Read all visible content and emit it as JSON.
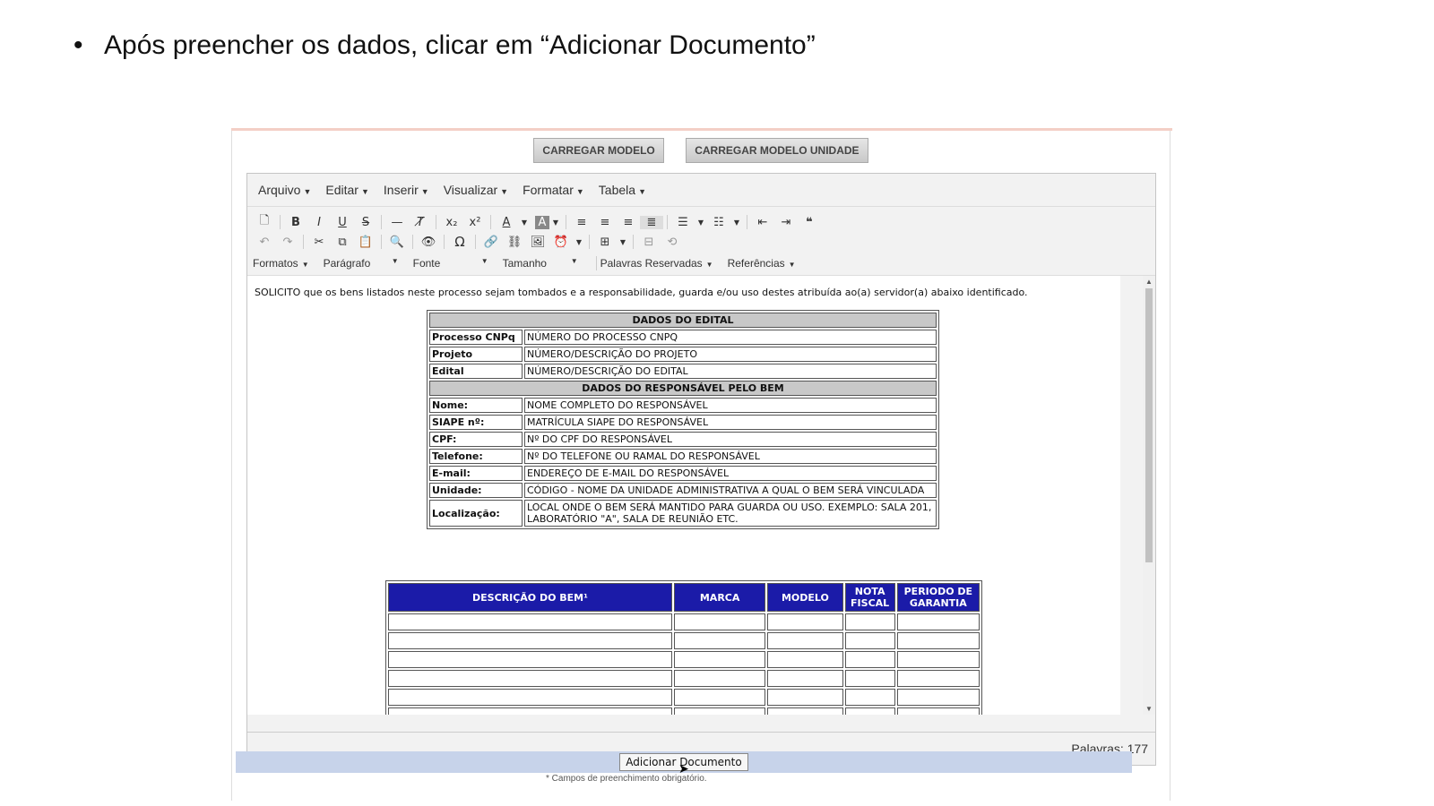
{
  "slide": {
    "bullet": "•",
    "text": "Após preencher os dados, clicar em “Adicionar Documento”"
  },
  "buttons": {
    "carregar_modelo": "CARREGAR MODELO",
    "carregar_modelo_unidade": "CARREGAR MODELO UNIDADE",
    "adicionar_documento": "Adicionar Documento"
  },
  "menu": [
    "Arquivo",
    "Editar",
    "Inserir",
    "Visualizar",
    "Formatar",
    "Tabela"
  ],
  "dropdowns": [
    "Formatos",
    "Parágrafo",
    "Fonte",
    "Tamanho",
    "Palavras Reservadas",
    "Referências"
  ],
  "content": {
    "intro": "SOLICITO que os bens listados neste processo sejam tombados e a responsabilidade, guarda e/ou uso destes atribuída ao(a) servidor(a) abaixo identificado.",
    "edital": {
      "header": "DADOS DO EDITAL",
      "rows": [
        {
          "k": "Processo CNPq",
          "v": "NÚMERO DO PROCESSO CNPQ"
        },
        {
          "k": "Projeto",
          "v": "NÚMERO/DESCRIÇÃO DO PROJETO"
        },
        {
          "k": "Edital",
          "v": "NÚMERO/DESCRIÇÃO DO EDITAL"
        }
      ],
      "header2": "DADOS DO RESPONSÁVEL PELO BEM",
      "rows2": [
        {
          "k": "Nome:",
          "v": "NOME COMPLETO DO RESPONSÁVEL"
        },
        {
          "k": "SIAPE nº:",
          "v": "MATRÍCULA SIAPE DO RESPONSÁVEL"
        },
        {
          "k": "CPF:",
          "v": "Nº DO CPF DO RESPONSÁVEL"
        },
        {
          "k": "Telefone:",
          "v": "Nº DO TELEFONE OU RAMAL DO RESPONSÁVEL"
        },
        {
          "k": "E-mail:",
          "v": "ENDEREÇO DE E-MAIL DO RESPONSÁVEL"
        },
        {
          "k": "Unidade:",
          "v": "CÓDIGO - NOME DA UNIDADE ADMINISTRATIVA A QUAL O BEM SERÁ VINCULADA"
        },
        {
          "k": "Localização:",
          "v": "LOCAL ONDE O BEM SERÁ MANTIDO PARA GUARDA OU USO. EXEMPLO: SALA 201, LABORATÓRIO \"A\", SALA DE REUNIÃO ETC."
        }
      ]
    },
    "bens_headers": [
      "DESCRIÇÃO DO BEM¹",
      "MARCA",
      "MODELO",
      "NOTA FISCAL",
      "PERIODO DE GARANTIA"
    ]
  },
  "status": {
    "words": "Palavras: 177"
  },
  "footer": {
    "required": "* Campos de preenchimento obrigatório."
  },
  "colors": {
    "table_header_blue": "#1b1ba8",
    "add_bar": "#c7d3ea"
  }
}
